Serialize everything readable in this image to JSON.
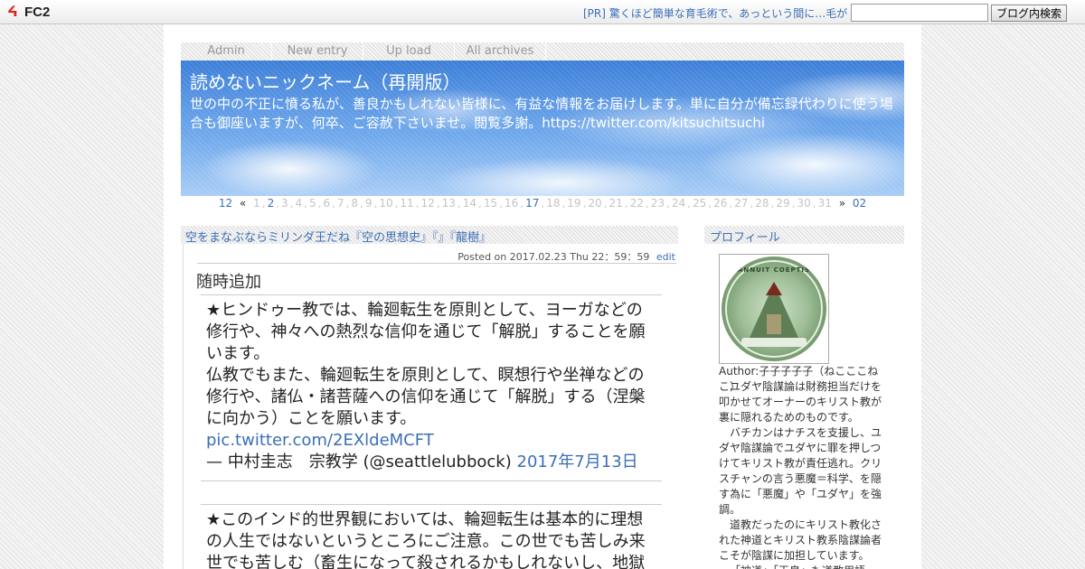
{
  "fc2": {
    "logo_text": "FC2",
    "pr_text": "[PR] 驚くほど簡単な育毛術で、あっという間に…毛が",
    "search_placeholder": "",
    "search_button": "ブログ内検索"
  },
  "menu": [
    {
      "label": "Admin"
    },
    {
      "label": "New entry"
    },
    {
      "label": "Up load"
    },
    {
      "label": "All archives"
    }
  ],
  "header": {
    "title": "読めないニックネーム（再開版）",
    "description": "世の中の不正に憤る私が、善良かもしれない皆様に、有益な情報をお届けします。単に自分が備忘録代わりに使う場合も御座いますが、何卒、ご容赦下さいませ。閲覧多謝。https://twitter.com/kitsuchitsuchi"
  },
  "calendar": {
    "prev_month": "12",
    "prev_arrow": "«",
    "days": [
      "1",
      "2",
      "3",
      "4",
      "5",
      "6",
      "7",
      "8",
      "9",
      "10",
      "11",
      "12",
      "13",
      "14",
      "15",
      "16",
      "17",
      "18",
      "19",
      "20",
      "21",
      "22",
      "23",
      "24",
      "25",
      "26",
      "27",
      "28",
      "29",
      "30",
      "31"
    ],
    "linked_days": [
      "2",
      "17"
    ],
    "next_arrow": "»",
    "next_month": "02"
  },
  "entry": {
    "title": "空をまなぶならミリンダ王だね『空の思想史』『』『龍樹』",
    "posted": "Posted on 2017.02.23 Thu 22：59：59",
    "edit": "edit",
    "addendum": "随時追加",
    "quote1_text": "★ヒンドゥー教では、輪廻転生を原則として、ヨーガなどの修行や、神々への熱烈な信仰を通じて「解脱」することを願います。\n仏教でもまた、輪廻転生を原則として、瞑想行や坐禅などの修行や、諸仏・諸菩薩への信仰を通じて「解脱」する（涅槃に向かう）ことを願います。",
    "quote1_link": "pic.twitter.com/2EXldeMCFT",
    "quote1_author": "— 中村圭志　宗教学 (@seattlelubbock)",
    "quote1_date": "2017年7月13日",
    "quote2_text": "★このインド的世界観においては、輪廻転生は基本的に理想の人生ではないというところにご注意。この世でも苦しみ来世でも苦しむ（畜生になって殺されるかもしれないし、地獄"
  },
  "sidebar": {
    "profile_title": "プロフィール",
    "avatar_motto": "ANNUIT COEPTIS",
    "author": "Author:子子子子子（ねこここねこ）",
    "profile_paragraphs": [
      "ユダヤ陰謀論は財務担当だけを叩かせてオーナーのキリスト教が裏に隠れるためのものです。",
      "バチカンはナチスを支援し、ユダヤ陰謀論でユダヤに罪を押しつけてキリスト教が責任逃れ。クリスチャンの言う悪魔＝科学、を隠す為に「悪魔」や「ユダヤ」を強調。",
      "道教だったのにキリスト教化された神道とキリスト教系陰謀論者こそが陰謀に加担しています。",
      "「神道」「天皇」も道教用語"
    ]
  }
}
